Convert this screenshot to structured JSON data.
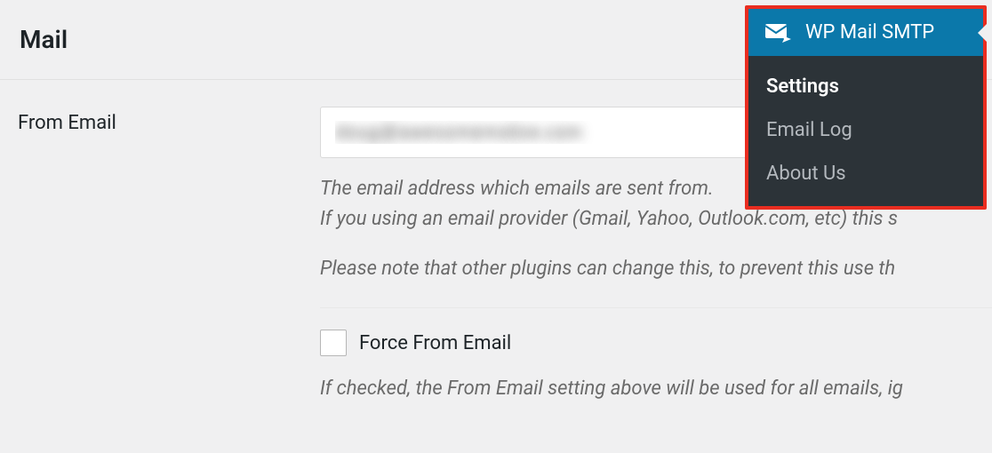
{
  "section": {
    "title": "Mail"
  },
  "from_email": {
    "label": "From Email",
    "value": "doug@awesomemotive.com",
    "description": "The email address which emails are sent from.\nIf you using an email provider (Gmail, Yahoo, Outlook.com, etc) this s",
    "note_line": "Please note that other plugins can change this, to prevent this use th"
  },
  "force_from": {
    "label": "Force From Email",
    "description": "If checked, the From Email setting above will be used for all emails, ig"
  },
  "menu": {
    "title": "WP Mail SMTP",
    "items": [
      {
        "label": "Settings",
        "active": true
      },
      {
        "label": "Email Log",
        "active": false
      },
      {
        "label": "About Us",
        "active": false
      }
    ]
  }
}
